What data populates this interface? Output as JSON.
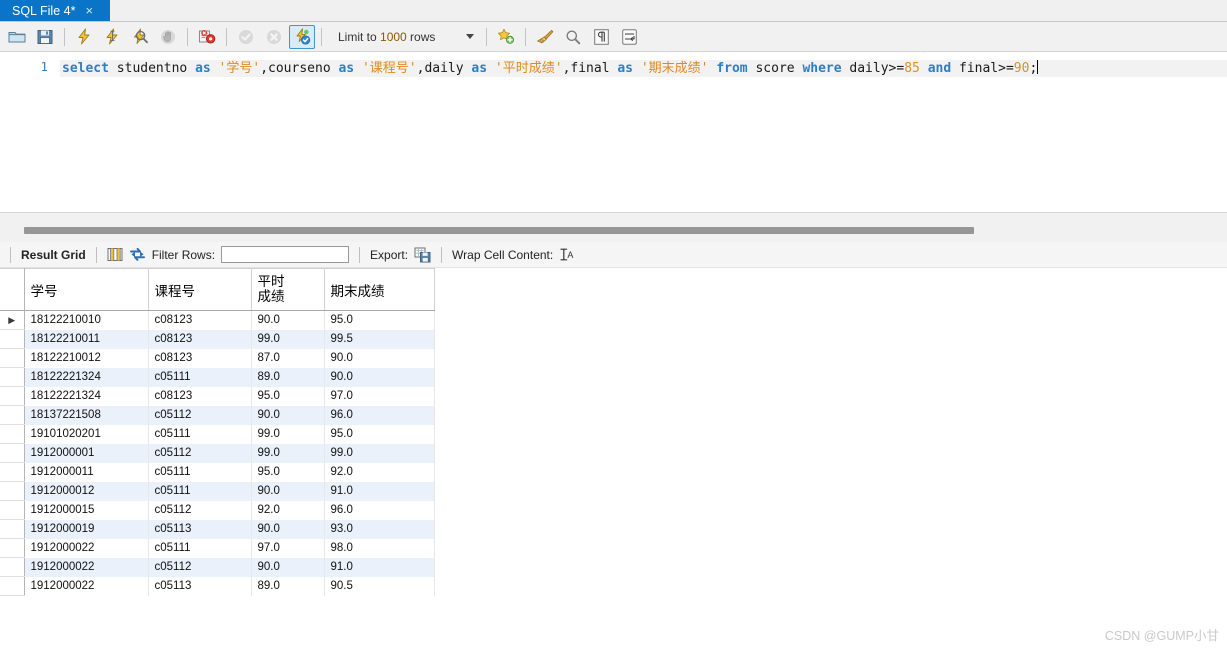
{
  "tab": {
    "label": "SQL File 4*",
    "close": "×"
  },
  "toolbar": {
    "buttons": [
      {
        "name": "open-sql-file",
        "icon": "folder-icon",
        "title": "Open SQL Script File"
      },
      {
        "name": "save-sql-file",
        "icon": "floppy-save-icon",
        "title": "Save Script"
      },
      {
        "name": "execute-statement",
        "icon": "lightning-icon",
        "title": "Execute"
      },
      {
        "name": "execute-current-statement",
        "icon": "lightning-cursor-icon",
        "title": "Execute Current Statement"
      },
      {
        "name": "explain-statement",
        "icon": "lightning-magnifier-icon",
        "title": "Explain Current Statement"
      },
      {
        "name": "stop-statement",
        "icon": "stop-hand-icon",
        "title": "Stop"
      },
      {
        "name": "toggle-stop-on-error",
        "icon": "stop-on-error-icon",
        "title": "Toggle whether execution should stop on error"
      },
      {
        "name": "commit-transaction",
        "icon": "commit-check-icon",
        "title": "Commit"
      },
      {
        "name": "rollback-transaction",
        "icon": "rollback-x-icon",
        "title": "Rollback"
      },
      {
        "name": "toggle-autocommit",
        "icon": "autocommit-icon",
        "title": "Toggle Auto-Commit Mode"
      }
    ],
    "limit_prefix": "Limit to ",
    "limit_number": "1000",
    "limit_suffix": " rows",
    "right_buttons": [
      {
        "name": "new-snippet",
        "icon": "star-add-icon",
        "title": "Save snippet"
      },
      {
        "name": "beautify-query",
        "icon": "broom-icon",
        "title": "Beautify/reformat SQL script"
      },
      {
        "name": "find-panel",
        "icon": "magnifier-icon",
        "title": "Show Find panel"
      },
      {
        "name": "toggle-invisible-chars",
        "icon": "pilcrow-icon",
        "title": "Toggle invisible characters"
      },
      {
        "name": "toggle-word-wrap",
        "icon": "wrap-text-icon",
        "title": "Toggle wrapping of long lines"
      }
    ]
  },
  "editor": {
    "line_number": "1",
    "sql_tokens": [
      {
        "t": "select",
        "c": "kw"
      },
      {
        "t": " studentno ",
        "c": "plain"
      },
      {
        "t": "as",
        "c": "kw"
      },
      {
        "t": " ",
        "c": "plain"
      },
      {
        "t": "'学号'",
        "c": "str"
      },
      {
        "t": ",courseno ",
        "c": "plain"
      },
      {
        "t": "as",
        "c": "kw"
      },
      {
        "t": " ",
        "c": "plain"
      },
      {
        "t": "'课程号'",
        "c": "str"
      },
      {
        "t": ",daily ",
        "c": "plain"
      },
      {
        "t": "as",
        "c": "kw"
      },
      {
        "t": " ",
        "c": "plain"
      },
      {
        "t": "'平时成绩'",
        "c": "str"
      },
      {
        "t": ",final ",
        "c": "plain"
      },
      {
        "t": "as",
        "c": "kw"
      },
      {
        "t": " ",
        "c": "plain"
      },
      {
        "t": "'期末成绩'",
        "c": "str"
      },
      {
        "t": " ",
        "c": "plain"
      },
      {
        "t": "from",
        "c": "kw"
      },
      {
        "t": " score ",
        "c": "plain"
      },
      {
        "t": "where",
        "c": "kw"
      },
      {
        "t": " daily>=",
        "c": "plain"
      },
      {
        "t": "85",
        "c": "num2"
      },
      {
        "t": " ",
        "c": "plain"
      },
      {
        "t": "and",
        "c": "kw"
      },
      {
        "t": " final>=",
        "c": "plain"
      },
      {
        "t": "90",
        "c": "num2"
      },
      {
        "t": ";",
        "c": "plain"
      }
    ]
  },
  "result_toolbar": {
    "result_grid_label": "Result Grid",
    "grid-view-icon": "grid-view-icon",
    "refresh-icon": "refresh-icon",
    "filter_label": "Filter Rows:",
    "filter_value": "",
    "filter_placeholder": "",
    "export_label": "Export:",
    "export-icon": "export-icon",
    "wrap_label": "Wrap Cell Content:",
    "wrap-icon": "wrap-cell-icon"
  },
  "grid": {
    "columns": [
      "学号",
      "课程号",
      "平时\n成绩",
      "期末成绩"
    ],
    "column_names": [
      "studentno",
      "courseno",
      "daily",
      "final"
    ],
    "active_row_marker": "▶",
    "rows": [
      {
        "marker": true,
        "cells": [
          "18122210010",
          "c08123",
          "90.0",
          "95.0"
        ]
      },
      {
        "marker": false,
        "cells": [
          "18122210011",
          "c08123",
          "99.0",
          "99.5"
        ]
      },
      {
        "marker": false,
        "cells": [
          "18122210012",
          "c08123",
          "87.0",
          "90.0"
        ]
      },
      {
        "marker": false,
        "cells": [
          "18122221324",
          "c05111",
          "89.0",
          "90.0"
        ]
      },
      {
        "marker": false,
        "cells": [
          "18122221324",
          "c08123",
          "95.0",
          "97.0"
        ]
      },
      {
        "marker": false,
        "cells": [
          "18137221508",
          "c05112",
          "90.0",
          "96.0"
        ]
      },
      {
        "marker": false,
        "cells": [
          "19101020201",
          "c05111",
          "99.0",
          "95.0"
        ]
      },
      {
        "marker": false,
        "cells": [
          "1912000001",
          "c05112",
          "99.0",
          "99.0"
        ]
      },
      {
        "marker": false,
        "cells": [
          "1912000011",
          "c05111",
          "95.0",
          "92.0"
        ]
      },
      {
        "marker": false,
        "cells": [
          "1912000012",
          "c05111",
          "90.0",
          "91.0"
        ]
      },
      {
        "marker": false,
        "cells": [
          "1912000015",
          "c05112",
          "92.0",
          "96.0"
        ]
      },
      {
        "marker": false,
        "cells": [
          "1912000019",
          "c05113",
          "90.0",
          "93.0"
        ]
      },
      {
        "marker": false,
        "cells": [
          "1912000022",
          "c05111",
          "97.0",
          "98.0"
        ]
      },
      {
        "marker": false,
        "cells": [
          "1912000022",
          "c05112",
          "90.0",
          "91.0"
        ]
      },
      {
        "marker": false,
        "cells": [
          "1912000022",
          "c05113",
          "89.0",
          "90.5"
        ]
      }
    ]
  },
  "watermark": "CSDN @GUMP小甘",
  "colors": {
    "tab_active": "#0a74c8",
    "keyword": "#2e7ec4",
    "string": "#e08a1e",
    "row_stripe": "#eaf1fb",
    "selected_button_border": "#3c96d4"
  }
}
